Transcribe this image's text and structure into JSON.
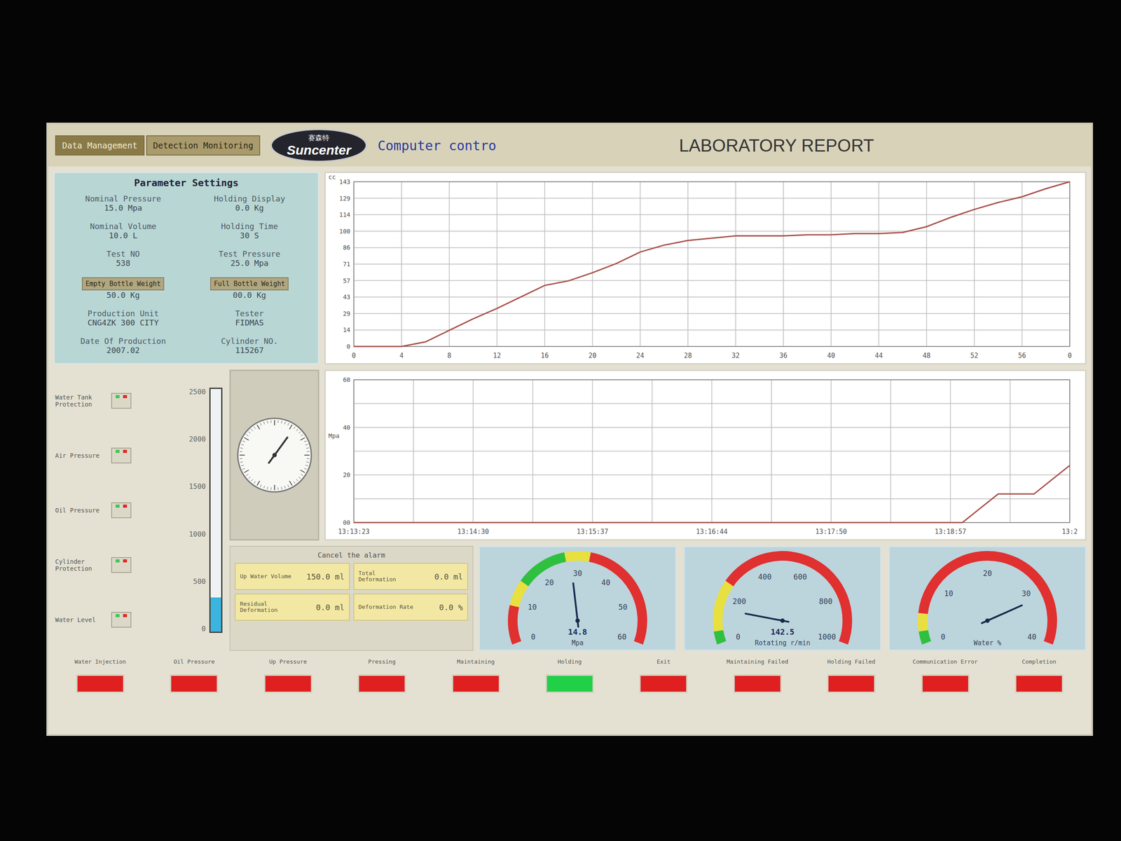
{
  "header": {
    "tabs": [
      {
        "label": "Data Management",
        "selected": true
      },
      {
        "label": "Detection Monitoring",
        "selected": false
      }
    ],
    "logo": {
      "cn": "赛森特",
      "en": "Suncenter"
    },
    "subtitle": "Computer contro",
    "title": "LABORATORY REPORT"
  },
  "parameters": {
    "title": "Parameter Settings",
    "items": [
      {
        "kind": "field",
        "label": "Nominal Pressure",
        "value": "15.0 Mpa"
      },
      {
        "kind": "field",
        "label": "Holding Display",
        "value": "0.0 Kg"
      },
      {
        "kind": "field",
        "label": "Nominal Volume",
        "value": "10.0 L"
      },
      {
        "kind": "field",
        "label": "Holding Time",
        "value": "30 S"
      },
      {
        "kind": "field",
        "label": "Test NO",
        "value": "538"
      },
      {
        "kind": "field",
        "label": "Test Pressure",
        "value": "25.0 Mpa"
      },
      {
        "kind": "button",
        "label": "Empty Bottle Weight",
        "value": "50.0 Kg"
      },
      {
        "kind": "button",
        "label": "Full Bottle Weight",
        "value": "00.0 Kg"
      },
      {
        "kind": "field",
        "label": "Production Unit",
        "value": "CNG4ZK 300 CITY"
      },
      {
        "kind": "field",
        "label": "Tester",
        "value": "FIDMAS"
      },
      {
        "kind": "field",
        "label": "Date Of Production",
        "value": "2007.02"
      },
      {
        "kind": "field",
        "label": "Cylinder NO.",
        "value": "115267"
      }
    ]
  },
  "volume_chart": {
    "unit": "cc",
    "y_ticks": [
      "143",
      "129",
      "114",
      "100",
      "86",
      "71",
      "57",
      "43",
      "29",
      "14",
      "0"
    ],
    "x_ticks": [
      "0",
      "4",
      "8",
      "12",
      "16",
      "20",
      "24",
      "28",
      "32",
      "36",
      "40",
      "44",
      "48",
      "52",
      "56",
      "0"
    ],
    "y_max": 143,
    "values": [
      0,
      0,
      0,
      4,
      14,
      24,
      33,
      43,
      53,
      57,
      64,
      72,
      82,
      88,
      92,
      94,
      96,
      96,
      96,
      97,
      97,
      98,
      98,
      99,
      104,
      112,
      119,
      125,
      130,
      137,
      143
    ]
  },
  "pressure_chart": {
    "unit": "Mpa",
    "y_ticks": [
      "60",
      "40",
      "20",
      "00"
    ],
    "x_ticks": [
      "13:13:23",
      "13:14:30",
      "13:15:37",
      "13:16:44",
      "13:17:50",
      "13:18:57",
      "13:2"
    ],
    "y_max": 60,
    "values": [
      0,
      0,
      0,
      0,
      0,
      0,
      0,
      0,
      0,
      0,
      0,
      0,
      0,
      0,
      0,
      0,
      0,
      0,
      0,
      0,
      0,
      0,
      0,
      0,
      0,
      0,
      0,
      0,
      0,
      0,
      0,
      0,
      0,
      0,
      0,
      6,
      12,
      12,
      12,
      18,
      24
    ]
  },
  "indicators": [
    {
      "label": "Water Tank Protection"
    },
    {
      "label": "Air Pressure"
    },
    {
      "label": "Oil Pressure"
    },
    {
      "label": "Cylinder Protection"
    },
    {
      "label": "Water Level"
    }
  ],
  "level_bar": {
    "ticks": [
      "2500",
      "2000",
      "1500",
      "1000",
      "500",
      "0"
    ],
    "level": 0.14
  },
  "dial": {
    "level": 0.1
  },
  "results": {
    "title": "Cancel the alarm",
    "fields": [
      {
        "label": "Up Water Volume",
        "value": "150.0 ml"
      },
      {
        "label": "Total Deformation",
        "value": "0.0 ml"
      },
      {
        "label": "Residual Deformation",
        "value": "0.0 ml"
      },
      {
        "label": "Deformation Rate",
        "value": "0.0 %"
      }
    ]
  },
  "gauges": [
    {
      "ticks": [
        "0",
        "10",
        "20",
        "30",
        "40",
        "50",
        "60"
      ],
      "reading": "14.8",
      "unit": "Mpa",
      "level": 0.47
    },
    {
      "ticks": [
        "0",
        "200",
        "400",
        "600",
        "800",
        "1000"
      ],
      "reading": "142.5",
      "unit": "Rotating r/min",
      "level": 0.14
    },
    {
      "ticks": [
        "0",
        "10",
        "20",
        "30",
        "40"
      ],
      "reading": "",
      "unit": "Water %",
      "level": 0.8
    }
  ],
  "lamps": [
    {
      "label": "Water Injection",
      "on": false
    },
    {
      "label": "Oil Pressure",
      "on": false
    },
    {
      "label": "Up Pressure",
      "on": false
    },
    {
      "label": "Pressing",
      "on": false
    },
    {
      "label": "Maintaining",
      "on": false
    },
    {
      "label": "Holding",
      "on": true
    },
    {
      "label": "Exit",
      "on": false
    },
    {
      "label": "Maintaining Failed",
      "on": false
    },
    {
      "label": "Holding Failed",
      "on": false
    },
    {
      "label": "Communication Error",
      "on": false
    },
    {
      "label": "Completion",
      "on": false
    }
  ]
}
